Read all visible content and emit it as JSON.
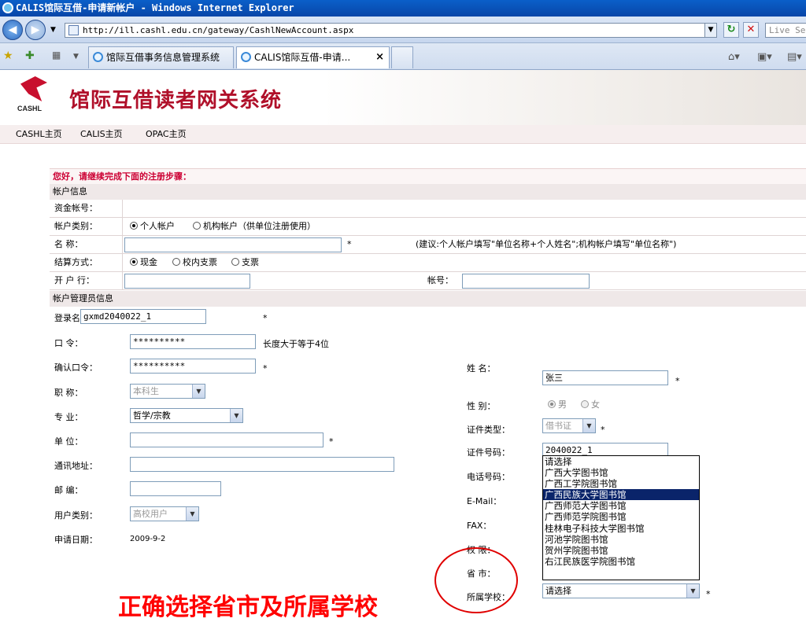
{
  "window": {
    "title": "CALIS馆际互借-申请新帐户 - Windows Internet Explorer"
  },
  "browser": {
    "url": "http://ill.cashl.edu.cn/gateway/CashlNewAccount.aspx",
    "search_placeholder": "Live Se",
    "tabs": [
      {
        "label": "馆际互借事务信息管理系统"
      },
      {
        "label": "CALIS馆际互借-申请..."
      }
    ],
    "tab_close": "×"
  },
  "site": {
    "logo_text": "CASHL",
    "system_name": "馆际互借读者网关系统",
    "nav": [
      "CASHL主页",
      "CALIS主页",
      "OPAC主页"
    ]
  },
  "form": {
    "prompt": "您好，请继续完成下面的注册步骤：",
    "section_account": "帐户信息",
    "account_no_label": "资金帐号：",
    "account_type_label": "帐户类别：",
    "account_type_options": [
      "个人帐户",
      "机构帐户（供单位注册使用）"
    ],
    "name_label": "名 称：",
    "name_hint": "(建议:个人帐户填写\"单位名称+个人姓名\";机构帐户填写\"单位名称\")",
    "settle_label": "结算方式：",
    "settle_options": [
      "现金",
      "校内支票",
      "支票"
    ],
    "bank_label": "开 户 行：",
    "bank_account_label": "帐号：",
    "section_admin": "帐户管理员信息",
    "login_label": "登录名：",
    "login_value": "gxmd2040022_1",
    "password_label": "口 令：",
    "password_value": "**********",
    "password_hint": "长度大于等于4位",
    "confirm_label": "确认口令：",
    "confirm_value": "**********",
    "title_label": "职 称：",
    "title_value": "本科生",
    "major_label": "专 业：",
    "major_value": "哲学/宗教",
    "unit_label": "单 位：",
    "address_label": "通讯地址：",
    "zip_label": "邮 编：",
    "usertype_label": "用户类别：",
    "usertype_value": "高校用户",
    "date_label": "申请日期：",
    "date_value": "2009-9-2",
    "realname_label": "姓 名：",
    "realname_value": "张三",
    "gender_label": "性 别：",
    "gender_options": [
      "男",
      "女"
    ],
    "idtype_label": "证件类型：",
    "idtype_value": "借书证",
    "idno_label": "证件号码：",
    "idno_value": "2040022_1",
    "phone_label": "电话号码：",
    "email_label": "E-Mail：",
    "fax_label": "FAX：",
    "perm_label": "权 限：",
    "province_label": "省 市：",
    "school_label": "所属学校：",
    "school_value": "请选择",
    "required_mark": "*"
  },
  "school_dropdown": [
    "请选择",
    "广西大学图书馆",
    "广西工学院图书馆",
    "广西民族大学图书馆",
    "广西师范大学图书馆",
    "广西师范学院图书馆",
    "桂林电子科技大学图书馆",
    "河池学院图书馆",
    "贺州学院图书馆",
    "右江民族医学院图书馆"
  ],
  "annotation": {
    "text": "正确选择省市及所属学校"
  }
}
